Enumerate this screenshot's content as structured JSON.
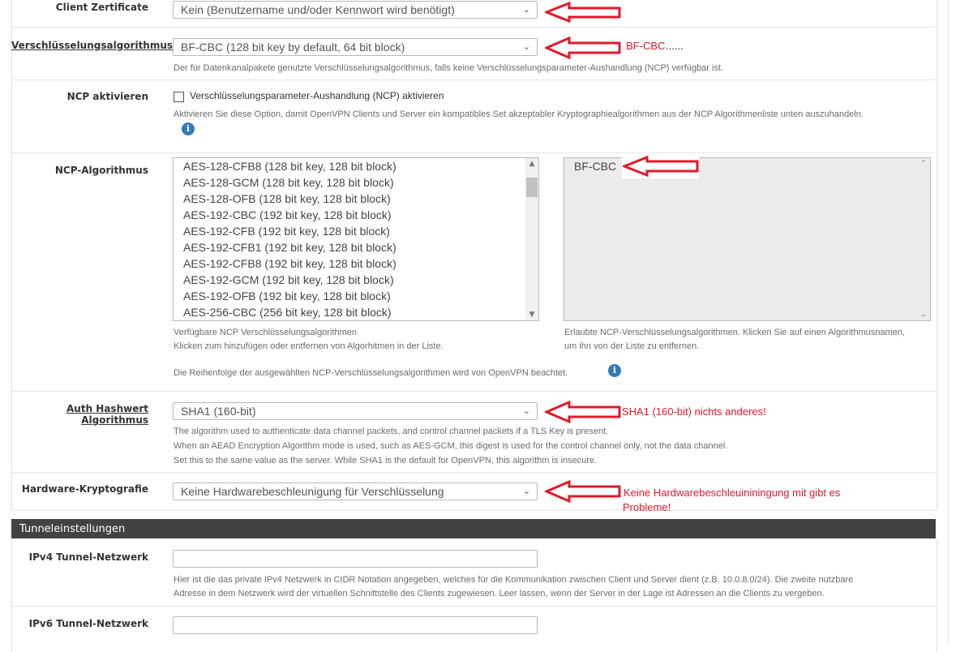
{
  "client_cert": {
    "label": "Client Zertificate",
    "value": "Kein (Benutzername und/oder Kennwort wird benötigt)"
  },
  "cipher": {
    "label": "Verschlüsselungsalgorithmus",
    "value": "BF-CBC (128 bit key by default, 64 bit block)",
    "help": "Der für Datenkanalpakete genutzte Verschlüsselungsalgorithmus, falls keine Verschlüsselungsparameter-Aushandlung (NCP) verfügbar ist.",
    "annotation": "BF-CBC",
    "annotation_dots": "......"
  },
  "ncp_enable": {
    "label": "NCP aktivieren",
    "checkbox_label": "Verschlüsselungsparameter-Aushandlung (NCP) aktivieren",
    "help": "Aktivieren Sie diese Option, damit OpenVPN Clients und Server ein kompatibles Set akzeptabler Kryptographiealgorithmen aus der NCP Algorithmenliste unten auszuhandeln.",
    "info_icon": "info-icon"
  },
  "ncp_algorithms": {
    "label": "NCP-Algorithmus",
    "available": [
      "AES-128-CFB8 (128 bit key, 128 bit block)",
      "AES-128-GCM (128 bit key, 128 bit block)",
      "AES-128-OFB (128 bit key, 128 bit block)",
      "AES-192-CBC (192 bit key, 128 bit block)",
      "AES-192-CFB (192 bit key, 128 bit block)",
      "AES-192-CFB1 (192 bit key, 128 bit block)",
      "AES-192-CFB8 (192 bit key, 128 bit block)",
      "AES-192-GCM (192 bit key, 128 bit block)",
      "AES-192-OFB (192 bit key, 128 bit block)",
      "AES-256-CBC (256 bit key, 128 bit block)"
    ],
    "allowed": [
      "BF-CBC"
    ],
    "help_available_1": "Verfügbare NCP Verschlüsselungsalgorithmen",
    "help_available_2": "Klicken zum hinzufügen oder entfernen von Algorhitmen in der Liste.",
    "help_allowed_1": "Erlaubte NCP-Verschlüsselungsalgorithmen. Klicken Sie auf einen Algorithmusnamen,",
    "help_allowed_2": "um ihn von der Liste zu entfernen.",
    "help_order": "Die Reihenfolge der ausgewählten NCP-Verschlüsselungsalgorithmen wird von OpenVPN beachtet."
  },
  "auth_digest": {
    "label": "Auth Hashwert Algorithmus",
    "value": "SHA1 (160-bit)",
    "help_1": "The algorithm used to authenticate data channel packets, and control channel packets if a TLS Key is present.",
    "help_2": "When an AEAD Encryption Algorithm mode is used, such as AES-GCM, this digest is used for the control channel only, not the data channel.",
    "help_3": "Set this to the same value as the server. While SHA1 is the default for OpenVPN, this algorithm is insecure.",
    "annotation": "SHA1 (160-bit) nichts anderes!"
  },
  "hw_crypto": {
    "label": "Hardware-Kryptografie",
    "value": "Keine Hardwarebeschleunigung für Verschlüsselung",
    "annotation_1": "Keine Hardwarebeschleuininingung mit gibt es",
    "annotation_2": "Probleme!"
  },
  "tunnel_section": {
    "title": "Tunneleinstellungen",
    "ipv4_label": "IPv4 Tunnel-Netzwerk",
    "ipv4_value": "",
    "ipv4_help_1": "Hier ist die das private IPv4 Netzwerk in CIDR Notation angegeben, welches für die Kommunikation zwischen Client und Server dient (z.B. 10.0.8.0/24). Die zweite nutzbare",
    "ipv4_help_2": "Adresse in dem Netzwerk wird der virtuellen Schnittstelle des Clients zugewiesen. Leer lassen, wenn der Server in der Lage ist Adressen an die Clients zu vergeben.",
    "ipv6_label": "IPv6 Tunnel-Netzwerk",
    "ipv6_value": ""
  },
  "colors": {
    "annotation_red": "#e0192a",
    "section_bar": "#424242",
    "info_blue": "#2f79c0"
  }
}
